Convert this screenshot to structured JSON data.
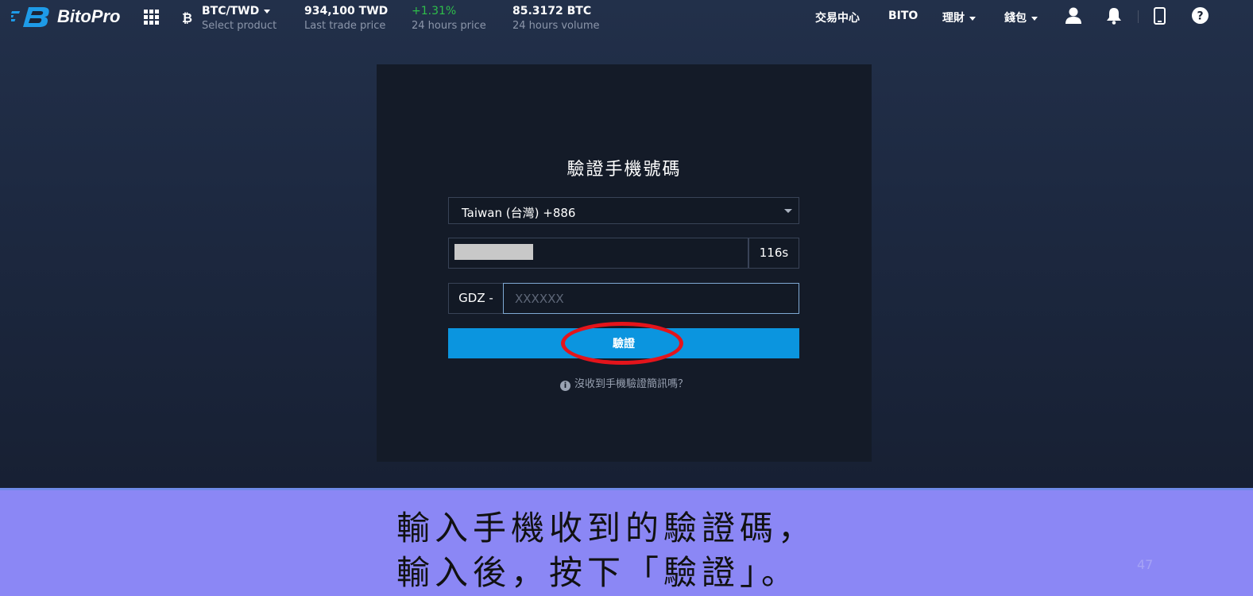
{
  "header": {
    "brand": "BitoPro",
    "pair": "BTC/TWD",
    "pair_label": "Select product",
    "btc_symbol": "₿",
    "last_price": "934,100 TWD",
    "last_price_label": "Last trade price",
    "change": "+1.31%",
    "change_label": "24 hours price",
    "volume": "85.3172 BTC",
    "volume_label": "24 hours volume",
    "nav": [
      "交易中心",
      "BITO",
      "理財",
      "錢包"
    ],
    "colors": {
      "up": "#2fbf4a",
      "brand": "#0b95df"
    }
  },
  "form": {
    "title": "驗證手機號碼",
    "country": "Taiwan (台灣) +886",
    "timer": "116s",
    "prefix": "GDZ -",
    "code_placeholder": "XXXXXX",
    "verify_label": "驗證",
    "help": "沒收到手機驗證簡訊嗎？",
    "info_glyph": "i"
  },
  "caption": {
    "line1": "輸入手機收到的驗證碼，",
    "line2": "輸入後，按下「驗證」。",
    "page_number": "47"
  },
  "icons": [
    "bitopro-logo-icon",
    "grid-menu-icon",
    "bitcoin-icon",
    "user-icon",
    "bell-icon",
    "mobile-icon",
    "help-icon",
    "info-icon",
    "dropdown-arrow-icon"
  ]
}
